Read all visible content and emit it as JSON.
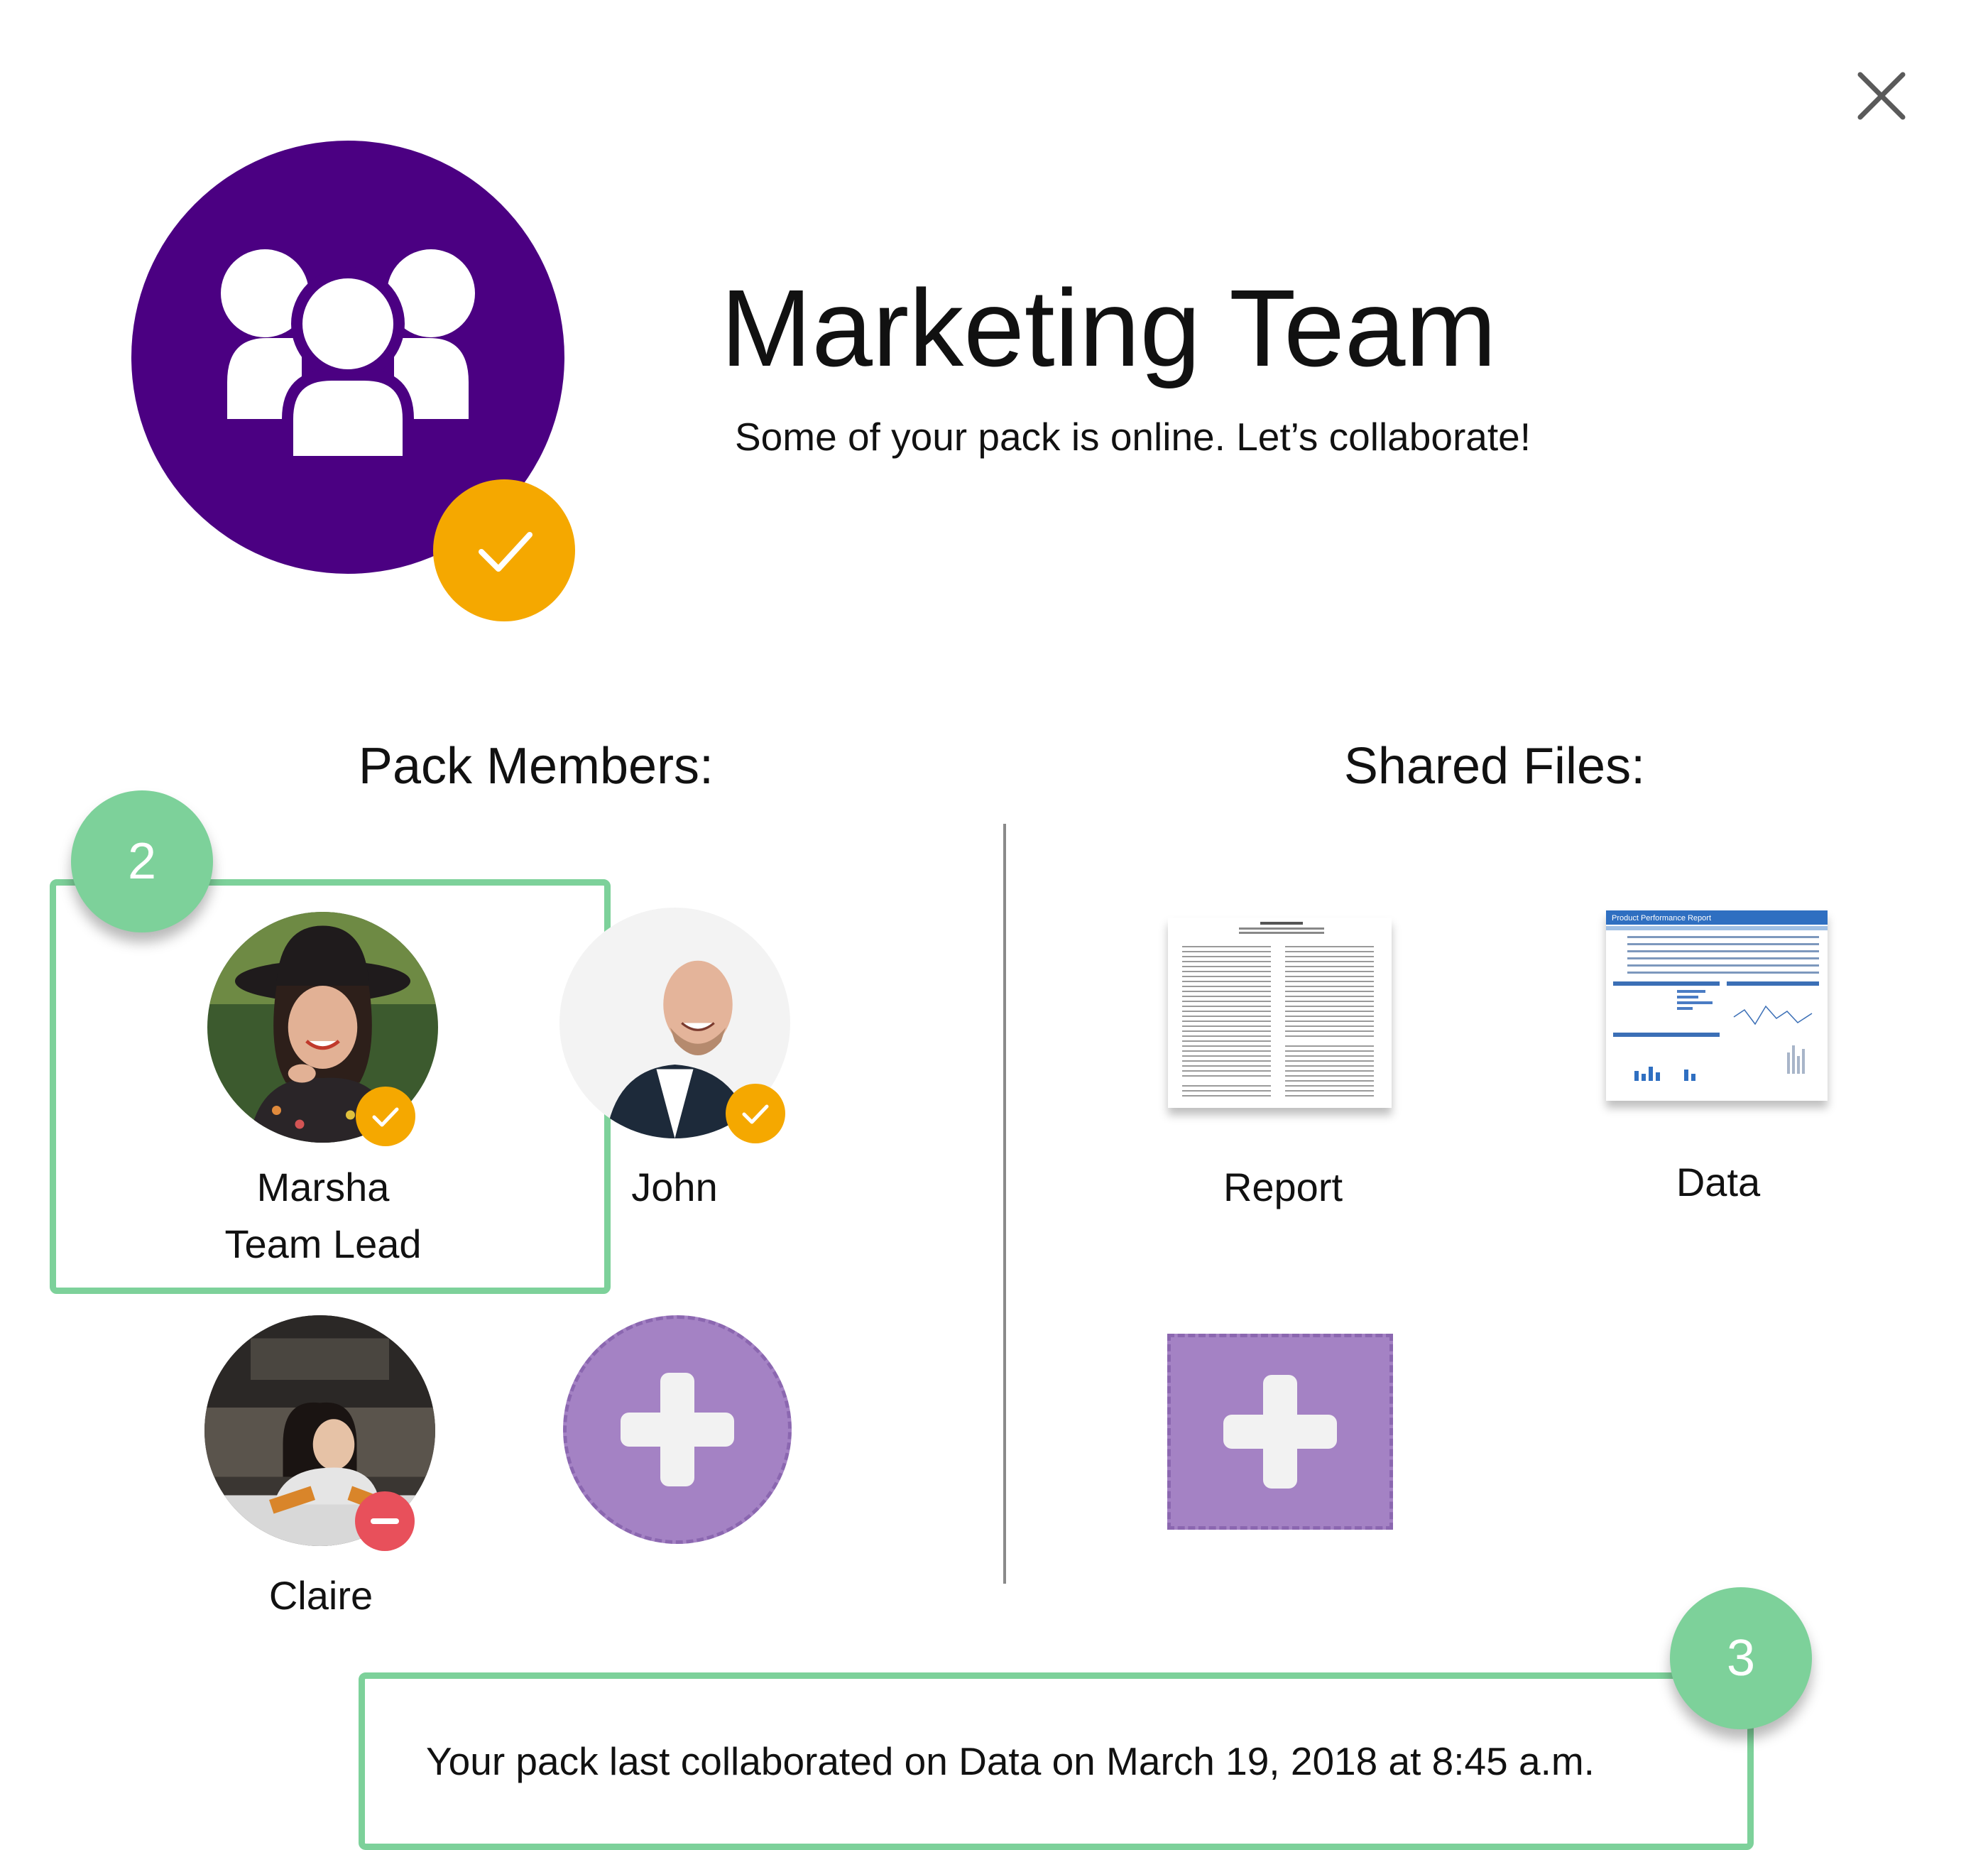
{
  "header": {
    "title": "Marketing Team",
    "subtitle": "Some of your pack is online. Let’s collaborate!"
  },
  "sections": {
    "members_heading": "Pack Members:",
    "files_heading": "Shared Files:"
  },
  "members": [
    {
      "name": "Marsha",
      "role": "Team Lead",
      "status": "online"
    },
    {
      "name": "John",
      "status": "online"
    },
    {
      "name": "Claire",
      "status": "away"
    }
  ],
  "files": [
    {
      "label": "Report"
    },
    {
      "label": "Data",
      "thumbnail_title": "Product Performance Report"
    }
  ],
  "steps": {
    "members": "2",
    "footer": "3"
  },
  "footer": {
    "message": "Your pack last collaborated on Data on March 19, 2018 at 8:45 a.m."
  },
  "colors": {
    "team_avatar": "#4b0082",
    "online_badge": "#f5a800",
    "away_badge": "#e8505b",
    "highlight": "#7dd19a",
    "add_button": "#a482c4"
  },
  "icons": {
    "close": "close-icon",
    "team": "team-icon",
    "check": "checkmark-icon",
    "remove": "minus-icon",
    "add": "plus-icon"
  }
}
